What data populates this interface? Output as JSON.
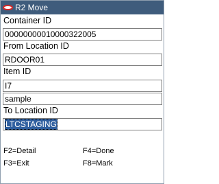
{
  "window": {
    "title": "R2 Move"
  },
  "form": {
    "container_label": "Container ID",
    "container_value": "00000000010000322005",
    "from_location_label": "From Location ID",
    "from_location_value": "RDOOR01",
    "item_label": "Item ID",
    "item_value": "I7",
    "item_desc_value": "sample",
    "to_location_label": "To Location ID",
    "to_location_value": "LTCSTAGING"
  },
  "function_keys": {
    "f2": "F2=Detail",
    "f4": "F4=Done",
    "f3": "F3=Exit",
    "f8": "F8=Mark"
  },
  "colors": {
    "titlebar": "#3f5c7c",
    "logo": "#d92826",
    "selection": "#2f5f9f"
  }
}
